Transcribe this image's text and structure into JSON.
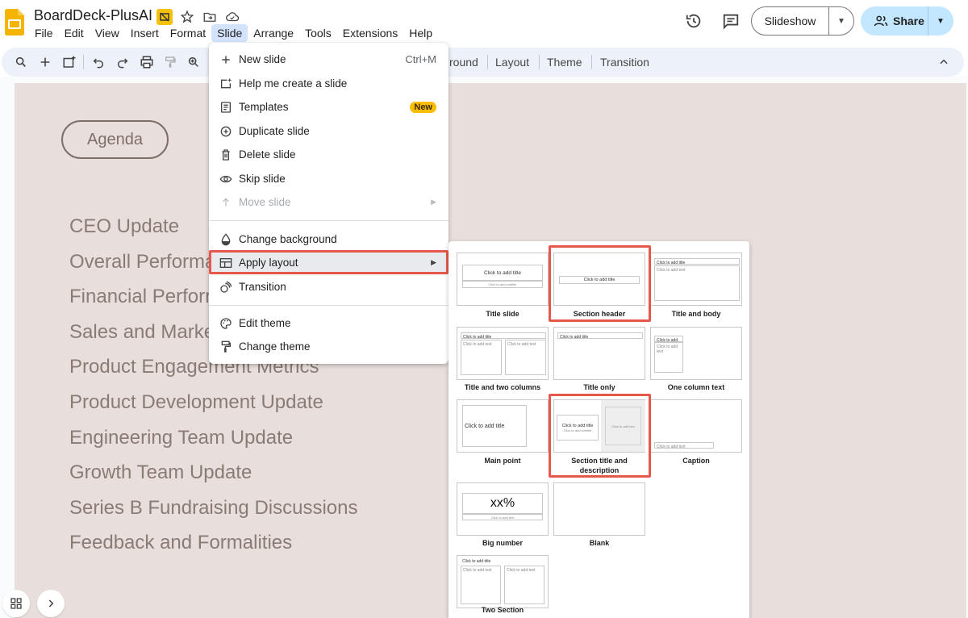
{
  "app": {
    "doc_title": "BoardDeck-PlusAI",
    "menu": [
      "File",
      "Edit",
      "View",
      "Insert",
      "Format",
      "Slide",
      "Arrange",
      "Tools",
      "Extensions",
      "Help"
    ],
    "active_menu": "Slide"
  },
  "header": {
    "slideshow_label": "Slideshow",
    "share_label": "Share"
  },
  "toolbar": {
    "tabs": [
      "round",
      "Layout",
      "Theme",
      "Transition"
    ]
  },
  "slide": {
    "pill": "Agenda",
    "items": [
      "CEO Update",
      "Overall Performa",
      "Financial Perforn",
      "Sales and Marke",
      "Product Engagement Metrics",
      "Product Development Update",
      "Engineering Team Update",
      "Growth Team Update",
      "Series B Fundraising Discussions",
      "Feedback and Formalities"
    ]
  },
  "slide_menu": {
    "items": [
      {
        "label": "New slide",
        "shortcut": "Ctrl+M",
        "icon": "plus-icon"
      },
      {
        "label": "Help me create a slide",
        "icon": "sparkle-slide-icon"
      },
      {
        "label": "Templates",
        "badge": "New",
        "icon": "templates-icon"
      },
      {
        "label": "Duplicate slide",
        "icon": "duplicate-icon"
      },
      {
        "label": "Delete slide",
        "icon": "trash-icon"
      },
      {
        "label": "Skip slide",
        "icon": "eye-icon"
      },
      {
        "label": "Move slide",
        "icon": "move-icon",
        "disabled": true
      },
      {
        "label": "Change background",
        "icon": "background-icon"
      },
      {
        "label": "Apply layout",
        "icon": "layout-icon",
        "highlighted": true
      },
      {
        "label": "Transition",
        "icon": "transition-icon"
      },
      {
        "label": "Edit theme",
        "icon": "palette-icon"
      },
      {
        "label": "Change theme",
        "icon": "paint-roller-icon"
      }
    ]
  },
  "layouts": {
    "labels": {
      "title_slide": "Title slide",
      "section_header": "Section header",
      "title_and_body": "Title and body",
      "title_two_columns": "Title and two columns",
      "title_only": "Title only",
      "one_column_text": "One column text",
      "main_point": "Main point",
      "section_title_desc": "Section title and description",
      "caption": "Caption",
      "big_number": "Big number",
      "blank": "Blank",
      "two_section": "Two Section"
    },
    "thumb_text": {
      "click_add_title": "Click to add title",
      "click_add_subtitle": "Click to add subtitle",
      "click_add_text": "Click to add text",
      "big_number_value": "xx%"
    }
  },
  "colors": {
    "highlight_box": "#e8584a",
    "slide_bg": "#e8dfdc",
    "share_bg": "#c2e7ff",
    "new_badge": "#fbbc04"
  }
}
